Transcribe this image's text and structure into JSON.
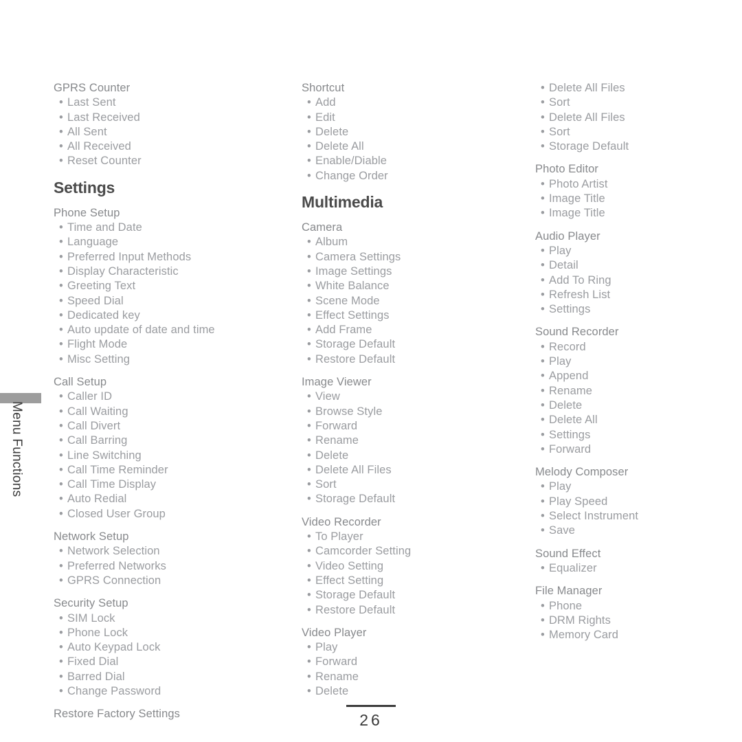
{
  "page": {
    "number": "26",
    "side_tab_label": "Menu Functions",
    "side_tab_bar_color": "#9d9d9d",
    "heading_color": "#4a4a4a",
    "section_title_color": "#87898c",
    "item_color": "#9a9ca0",
    "background_color": "#ffffff",
    "bullet_glyph": "•"
  },
  "columns": [
    {
      "id": "column-1",
      "blocks": [
        {
          "type": "section",
          "title": "GPRS Counter",
          "items": [
            "Last Sent",
            "Last Received",
            "All Sent",
            "All Received",
            "Reset Counter"
          ]
        },
        {
          "type": "chapter",
          "title": "Settings"
        },
        {
          "type": "section",
          "title": "Phone Setup",
          "items": [
            "Time and Date",
            "Language",
            "Preferred Input Methods",
            "Display Characteristic",
            "Greeting Text",
            "Speed Dial",
            "Dedicated key",
            "Auto update of date and time",
            "Flight Mode",
            "Misc Setting"
          ]
        },
        {
          "type": "section",
          "title": "Call Setup",
          "items": [
            "Caller ID",
            "Call Waiting",
            "Call Divert",
            "Call Barring",
            "Line Switching",
            "Call Time Reminder",
            "Call Time Display",
            "Auto Redial",
            "Closed User Group"
          ]
        },
        {
          "type": "section",
          "title": "Network Setup",
          "items": [
            "Network Selection",
            "Preferred Networks",
            "GPRS Connection"
          ]
        },
        {
          "type": "section",
          "title": "Security Setup",
          "items": [
            "SIM Lock",
            "Phone Lock",
            "Auto Keypad Lock",
            "Fixed Dial",
            "Barred Dial",
            "Change Password"
          ]
        },
        {
          "type": "section",
          "title": "Restore Factory Settings",
          "items": []
        }
      ]
    },
    {
      "id": "column-2",
      "blocks": [
        {
          "type": "section",
          "title": "Shortcut",
          "items": [
            "Add",
            "Edit",
            "Delete",
            "Delete All",
            "Enable/Diable",
            "Change Order"
          ]
        },
        {
          "type": "chapter",
          "title": "Multimedia"
        },
        {
          "type": "section",
          "title": "Camera",
          "items": [
            "Album",
            "Camera Settings",
            "Image Settings",
            "White Balance",
            "Scene Mode",
            "Effect Settings",
            "Add Frame",
            "Storage Default",
            "Restore Default"
          ]
        },
        {
          "type": "section",
          "title": "Image Viewer",
          "items": [
            "View",
            "Browse Style",
            "Forward",
            "Rename",
            "Delete",
            "Delete All Files",
            "Sort",
            "Storage Default"
          ]
        },
        {
          "type": "section",
          "title": "Video Recorder",
          "items": [
            "To Player",
            "Camcorder Setting",
            "Video Setting",
            "Effect Setting",
            "Storage Default",
            "Restore Default"
          ]
        },
        {
          "type": "section",
          "title": "Video Player",
          "items": [
            "Play",
            "Forward",
            "Rename",
            "Delete"
          ]
        }
      ]
    },
    {
      "id": "column-3",
      "blocks": [
        {
          "type": "orphan",
          "title": "",
          "items": [
            "Delete All Files",
            "Sort",
            "Delete All Files",
            "Sort",
            "Storage Default"
          ]
        },
        {
          "type": "section",
          "title": "Photo Editor",
          "items": [
            "Photo Artist",
            "Image Title",
            "Image Title"
          ]
        },
        {
          "type": "section",
          "title": "Audio Player",
          "items": [
            "Play",
            "Detail",
            "Add To Ring",
            "Refresh List",
            "Settings"
          ]
        },
        {
          "type": "section",
          "title": "Sound Recorder",
          "items": [
            "Record",
            "Play",
            "Append",
            "Rename",
            "Delete",
            "Delete All",
            "Settings",
            "Forward"
          ]
        },
        {
          "type": "section",
          "title": "Melody Composer",
          "items": [
            "Play",
            "Play Speed",
            "Select Instrument",
            "Save"
          ]
        },
        {
          "type": "section",
          "title": "Sound Effect",
          "items": [
            "Equalizer"
          ]
        },
        {
          "type": "section",
          "title": "File Manager",
          "items": [
            "Phone",
            "DRM Rights",
            "Memory Card"
          ]
        }
      ]
    }
  ]
}
